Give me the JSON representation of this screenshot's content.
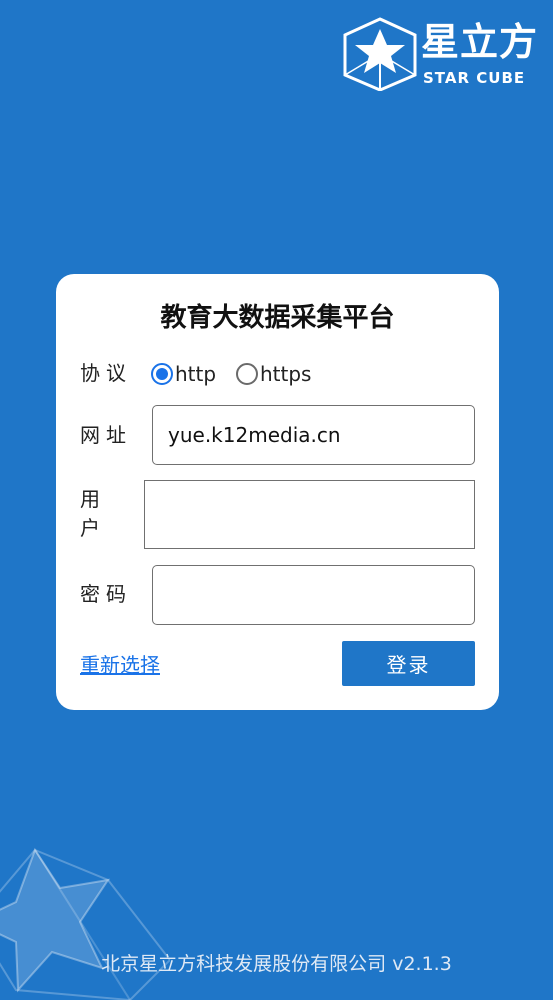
{
  "logo": {
    "name": "星立方",
    "subtitle": "STAR CUBE"
  },
  "form": {
    "title": "教育大数据采集平台",
    "protocol_label": "协议",
    "protocol_options": [
      "http",
      "https"
    ],
    "protocol_selected": "http",
    "url_label": "网址",
    "url_value": "yue.k12media.cn",
    "user_label_line1": "用",
    "user_label_line2": "户",
    "user_value": "",
    "password_label": "密码",
    "password_value": "",
    "reselect_link": "重新选择",
    "login_button": "登录"
  },
  "footer": {
    "text": "北京星立方科技发展股份有限公司 v2.1.3"
  },
  "colors": {
    "background": "#1f76c8",
    "accent": "#1a73e8",
    "card": "#ffffff"
  },
  "icons": {
    "logo": "star-cube-logo-icon",
    "radio_checked": "radio-checked-icon",
    "radio_unchecked": "radio-unchecked-icon",
    "decoration": "star-watermark-icon"
  }
}
